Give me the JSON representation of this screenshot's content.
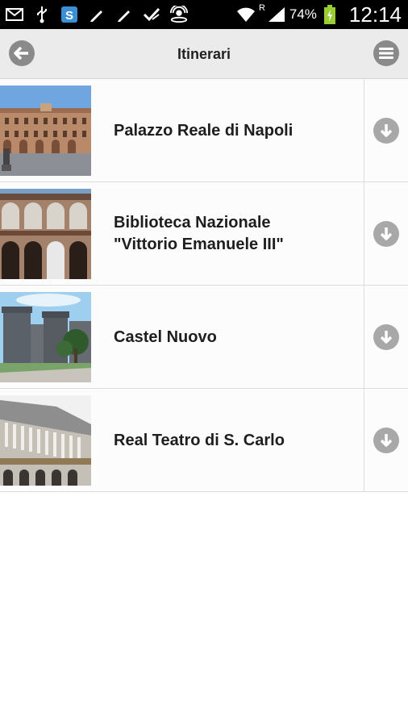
{
  "status_bar": {
    "battery_percent": "74%",
    "time": "12:14",
    "roaming_indicator": "R",
    "icons": [
      "mail-icon",
      "usb-icon",
      "skype-icon",
      "pencil-icon",
      "pencil-icon",
      "checkmark-icon",
      "satellite-icon",
      "wifi-icon",
      "signal-icon",
      "battery-icon"
    ]
  },
  "header": {
    "title": "Itinerari",
    "back_icon": "arrow-left-icon",
    "menu_icon": "menu-icon"
  },
  "items": [
    {
      "label": "Palazzo Reale di Napoli",
      "thumb": "palazzo-reale-photo",
      "action_icon": "download-icon"
    },
    {
      "label": "Biblioteca Nazionale\n\"Vittorio Emanuele III\"",
      "thumb": "biblioteca-nazionale-photo",
      "action_icon": "download-icon"
    },
    {
      "label": "Castel Nuovo",
      "thumb": "castel-nuovo-photo",
      "action_icon": "download-icon"
    },
    {
      "label": "Real Teatro di S. Carlo",
      "thumb": "teatro-san-carlo-photo",
      "action_icon": "download-icon"
    }
  ]
}
